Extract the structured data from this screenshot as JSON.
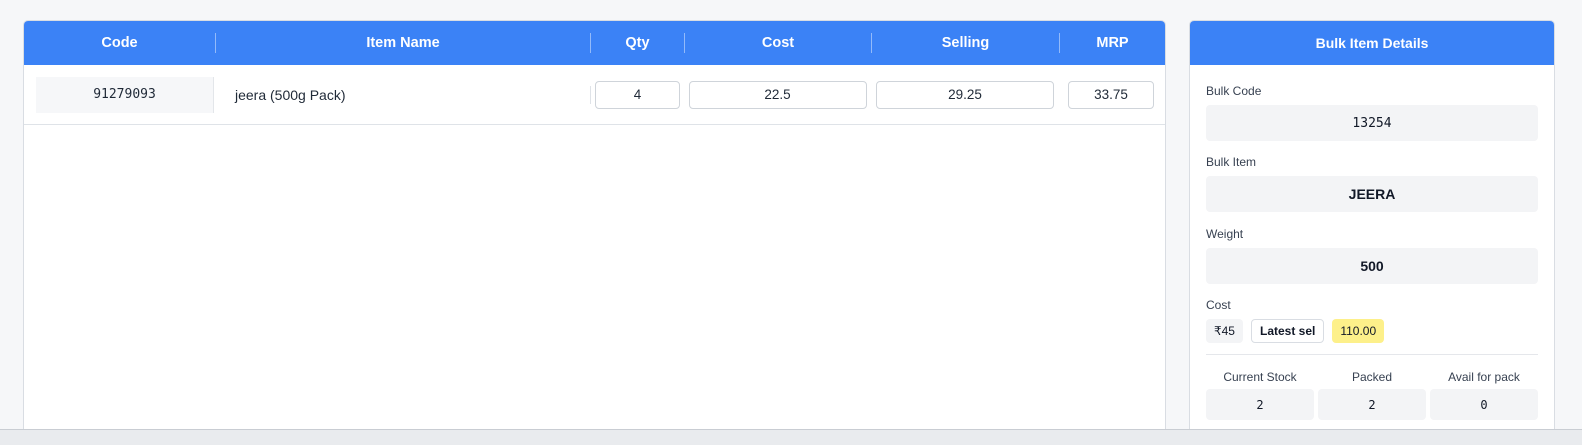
{
  "table": {
    "headers": {
      "code": "Code",
      "item_name": "Item Name",
      "qty": "Qty",
      "cost": "Cost",
      "selling": "Selling",
      "mrp": "MRP"
    },
    "rows": [
      {
        "code": "91279093",
        "item_name": "jeera (500g Pack)",
        "qty": "4",
        "cost": "22.5",
        "selling": "29.25",
        "mrp": "33.75"
      }
    ]
  },
  "details": {
    "title": "Bulk Item Details",
    "bulk_code_label": "Bulk Code",
    "bulk_code": "13254",
    "bulk_item_label": "Bulk Item",
    "bulk_item": "JEERA",
    "weight_label": "Weight",
    "weight": "500",
    "cost_label": "Cost",
    "cost_value": "₹45",
    "latest_sel_label": "Latest sel",
    "latest_sel_value": "110.00",
    "stock": {
      "current_label": "Current Stock",
      "current": "2",
      "packed_label": "Packed",
      "packed": "2",
      "avail_label": "Avail for pack",
      "avail": "0"
    }
  },
  "colors": {
    "accent": "#3b82f6",
    "highlight": "#fdf08a"
  }
}
